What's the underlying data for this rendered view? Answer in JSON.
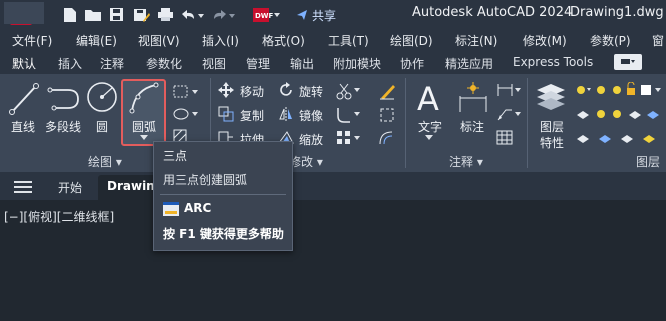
{
  "titlebar": {
    "app_logo": "A",
    "share_label": "共享",
    "app_title": "Autodesk AutoCAD 2024",
    "doc_title": "Drawing1.dwg",
    "quick_access_icons": [
      "new-icon",
      "open-icon",
      "save-icon",
      "save-as-icon",
      "plot-icon",
      "undo-icon",
      "redo-icon",
      "dwf-icon",
      "share-icon"
    ]
  },
  "menu": [
    "文件(F)",
    "编辑(E)",
    "视图(V)",
    "插入(I)",
    "格式(O)",
    "工具(T)",
    "绘图(D)",
    "标注(N)",
    "修改(M)",
    "参数(P)",
    "窗"
  ],
  "ribbon_tabs": [
    "默认",
    "插入",
    "注释",
    "参数化",
    "视图",
    "管理",
    "输出",
    "附加模块",
    "协作",
    "精选应用",
    "Express Tools"
  ],
  "ribbon": {
    "draw": {
      "line": "直线",
      "polyline": "多段线",
      "circle": "圆",
      "arc": "圆弧",
      "panel_title": "绘图 ▾"
    },
    "modify": {
      "move": "移动",
      "rotate": "旋转",
      "copy": "复制",
      "mirror": "镜像",
      "stretch": "拉伸",
      "scale": "缩放",
      "panel_title": "修改 ▾"
    },
    "annotation": {
      "text": "文字",
      "dimension": "标注",
      "panel_title": "注释 ▾"
    },
    "layers": {
      "layer_props_line1": "图层",
      "layer_props_line2": "特性",
      "panel_title": "图层"
    }
  },
  "file_tabs": {
    "start": "开始",
    "drawing": "Drawing"
  },
  "viewport": {
    "controls": "[−][俯视][二维线框]"
  },
  "tooltip": {
    "title": "三点",
    "description": "用三点创建圆弧",
    "command": "ARC",
    "help": "按 F1 键获得更多帮助"
  },
  "colors": {
    "titlebar_bg": "#2b3441",
    "ribbon_bg": "#3c4757",
    "canvas_bg": "#212830",
    "highlight": "#e35d5d",
    "brand_red": "#c8102e"
  }
}
